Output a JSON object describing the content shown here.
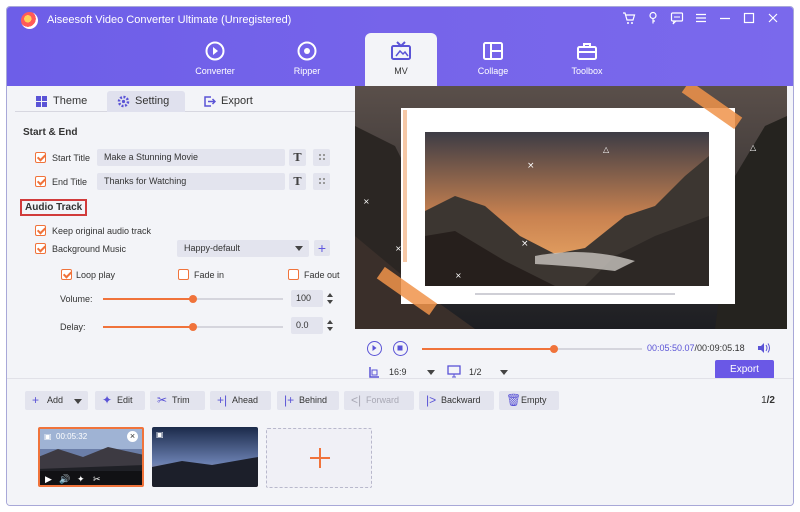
{
  "window": {
    "title": "Aiseesoft Video Converter Ultimate (Unregistered)",
    "controls": [
      "cart-icon",
      "key-icon",
      "chat-icon",
      "menu-icon",
      "minimize-icon",
      "maximize-icon",
      "close-icon"
    ]
  },
  "nav": {
    "items": [
      {
        "label": "Converter",
        "icon": "converter-icon"
      },
      {
        "label": "Ripper",
        "icon": "ripper-icon"
      },
      {
        "label": "MV",
        "icon": "mv-icon",
        "active": true
      },
      {
        "label": "Collage",
        "icon": "collage-icon"
      },
      {
        "label": "Toolbox",
        "icon": "toolbox-icon"
      }
    ]
  },
  "tabs": {
    "theme": "Theme",
    "setting": "Setting",
    "export": "Export",
    "active": "Setting"
  },
  "start_end": {
    "heading": "Start & End",
    "start_label": "Start Title",
    "start_value": "Make a Stunning Movie",
    "start_checked": true,
    "end_label": "End Title",
    "end_value": "Thanks for Watching",
    "end_checked": true
  },
  "audio": {
    "heading": "Audio Track",
    "keep_original": "Keep original audio track",
    "keep_original_checked": true,
    "bg_music": "Background Music",
    "bg_music_checked": true,
    "bg_music_value": "Happy-default",
    "loop_play": "Loop play",
    "loop_checked": true,
    "fade_in": "Fade in",
    "fade_in_checked": false,
    "fade_out": "Fade out",
    "fade_out_checked": false,
    "volume_label": "Volume:",
    "volume_value": "100",
    "volume_level": 0.5,
    "delay_label": "Delay:",
    "delay_value": "0.0",
    "delay_level": 0.5
  },
  "player": {
    "current_time": "00:05:50.07",
    "total_time": "/00:09:05.18",
    "progress": 0.6,
    "aspect": "16:9",
    "screen": "1/2",
    "export_label": "Export"
  },
  "toolbar": {
    "add": "Add",
    "edit": "Edit",
    "trim": "Trim",
    "ahead": "Ahead",
    "behind": "Behind",
    "forward": "Forward",
    "backward": "Backward",
    "empty": "Empty",
    "page_current": "1",
    "page_total": "/2"
  },
  "clips": [
    {
      "duration": "00:05:32",
      "selected": true
    },
    {
      "duration": "",
      "selected": false
    }
  ],
  "colors": {
    "accent": "#6a58e6",
    "orange": "#f0733b",
    "highlight_box": "#d13b3b"
  }
}
